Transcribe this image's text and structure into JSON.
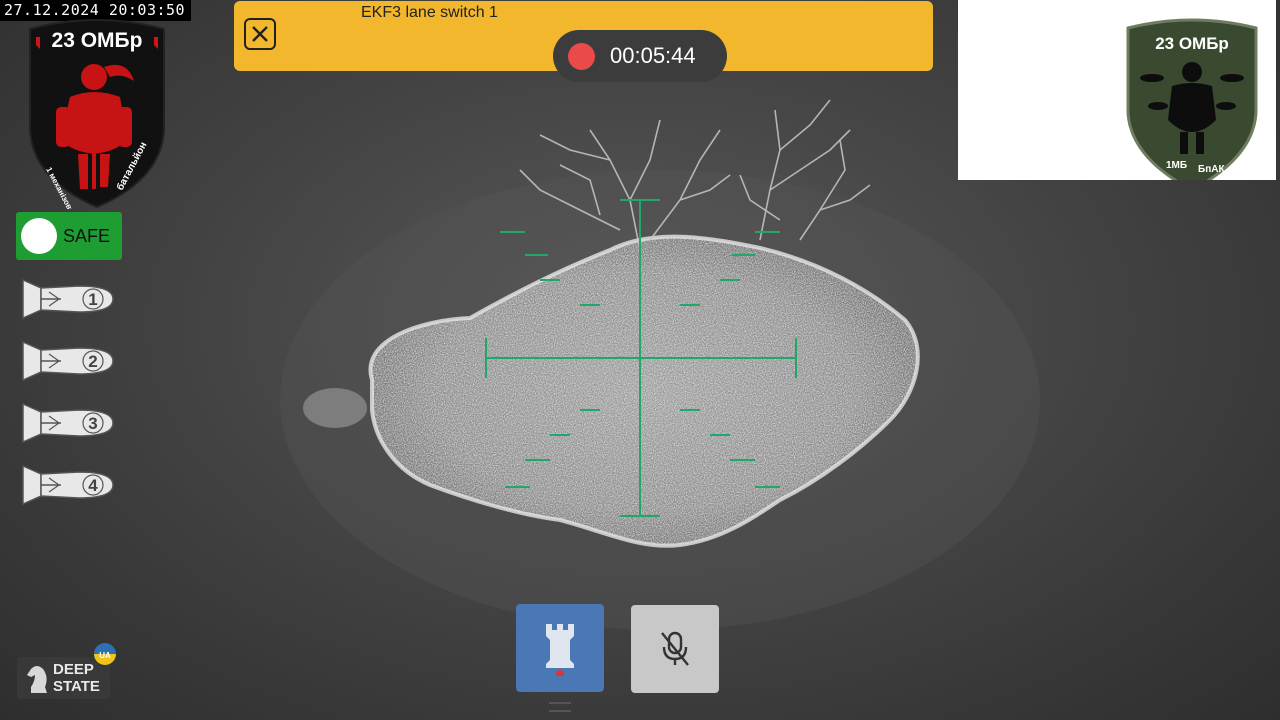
{
  "overlay": {
    "timestamp": "27.12.2024 20:03:50"
  },
  "banner": {
    "title": "EKF3 lane switch 1",
    "close_icon": "close-icon"
  },
  "recording": {
    "time": "00:05:44",
    "indicator_color": "#ea4a4a"
  },
  "left_patch": {
    "text": "23 ОМБр",
    "text_lower_left": "1 механізований",
    "text_lower_right": "батальйон",
    "accent_color": "#d01515"
  },
  "right_patch": {
    "text": "23 ОМБр",
    "text_lower_left": "1МБ",
    "text_lower_right": "БпАК",
    "color": "#3a4a30"
  },
  "safety": {
    "label": "SAFE",
    "color": "#1e9d32"
  },
  "munitions": [
    {
      "number": "1",
      "icon": "bomb-icon"
    },
    {
      "number": "2",
      "icon": "bomb-icon"
    },
    {
      "number": "3",
      "icon": "bomb-icon"
    },
    {
      "number": "4",
      "icon": "bomb-icon"
    }
  ],
  "controls": {
    "tower_icon": "tower-icon",
    "mic_icon": "mic-muted-icon"
  },
  "watermark": {
    "line1": "DEEP",
    "line2": "STATE",
    "flag_text": "UA"
  },
  "colors": {
    "banner": "#f3b72d",
    "reticle": "#1fa86a",
    "tower_button": "#4a78b4",
    "mic_button": "#c8c8c8"
  }
}
